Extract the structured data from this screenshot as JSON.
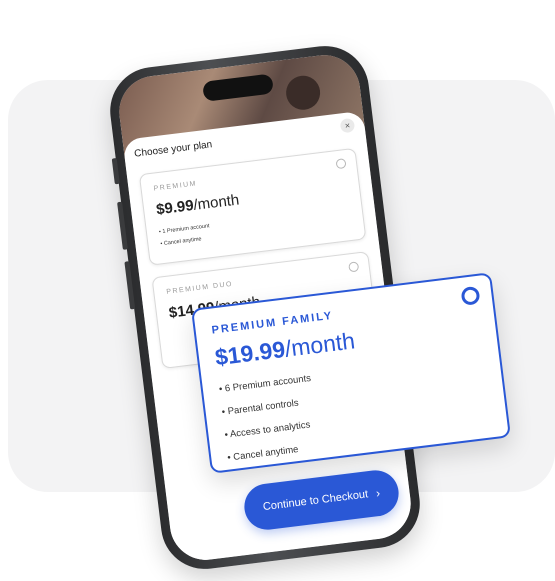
{
  "sheet": {
    "title": "Choose your plan",
    "close_icon": "close-icon"
  },
  "plans": [
    {
      "name": "PREMIUM",
      "price": "$9.99",
      "period": "/month",
      "features": [
        "• 1 Premium account",
        "• Cancel anytime"
      ]
    },
    {
      "name": "PREMIUM DUO",
      "price": "$14.99",
      "period": "/month",
      "features": []
    }
  ],
  "selected_plan": {
    "name": "PREMIUM FAMILY",
    "price": "$19.99",
    "period": "/month",
    "features": [
      "• 6 Premium accounts",
      "• Parental controls",
      "• Access to analytics",
      "• Cancel anytime"
    ]
  },
  "checkout": {
    "label": "Continue to Checkout",
    "chevron": "›"
  },
  "colors": {
    "accent": "#2a58d6",
    "background_panel": "#f3f3f4"
  }
}
